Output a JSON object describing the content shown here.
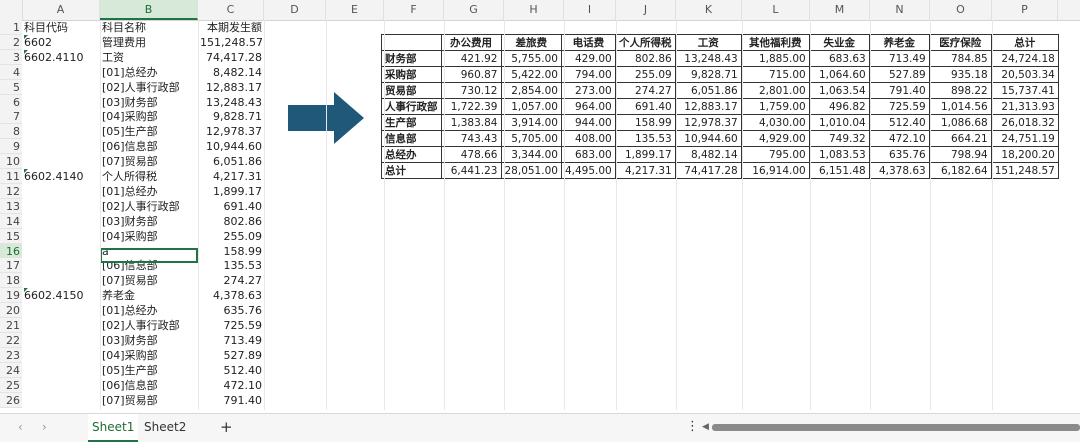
{
  "columns": [
    "A",
    "B",
    "C",
    "D",
    "E",
    "F",
    "G",
    "H",
    "I",
    "J",
    "K",
    "L",
    "M",
    "N",
    "O",
    "P"
  ],
  "rows": [
    {
      "n": "1",
      "a": "科目代码",
      "b": "科目名称",
      "c": "本期发生额"
    },
    {
      "n": "2",
      "a": "6602",
      "b": "管理费用",
      "c": "151,248.57"
    },
    {
      "n": "3",
      "a": "6602.4110",
      "b": "工资",
      "c": "74,417.28"
    },
    {
      "n": "4",
      "a": "",
      "b": "[01]总经办",
      "c": "8,482.14"
    },
    {
      "n": "5",
      "a": "",
      "b": "[02]人事行政部",
      "c": "12,883.17"
    },
    {
      "n": "6",
      "a": "",
      "b": "[03]财务部",
      "c": "13,248.43"
    },
    {
      "n": "7",
      "a": "",
      "b": "[04]采购部",
      "c": "9,828.71"
    },
    {
      "n": "8",
      "a": "",
      "b": "[05]生产部",
      "c": "12,978.37"
    },
    {
      "n": "9",
      "a": "",
      "b": "[06]信息部",
      "c": "10,944.60"
    },
    {
      "n": "10",
      "a": "",
      "b": "[07]贸易部",
      "c": "6,051.86"
    },
    {
      "n": "11",
      "a": "6602.4140",
      "b": "个人所得税",
      "c": "4,217.31"
    },
    {
      "n": "12",
      "a": "",
      "b": "[01]总经办",
      "c": "1,899.17"
    },
    {
      "n": "13",
      "a": "",
      "b": "[02]人事行政部",
      "c": "691.40"
    },
    {
      "n": "14",
      "a": "",
      "b": "[03]财务部",
      "c": "802.86"
    },
    {
      "n": "15",
      "a": "",
      "b": "[04]采购部",
      "c": "255.09"
    },
    {
      "n": "16",
      "a": "",
      "b": "a",
      "c": "158.99"
    },
    {
      "n": "17",
      "a": "",
      "b": "[06]信息部",
      "c": "135.53"
    },
    {
      "n": "18",
      "a": "",
      "b": "[07]贸易部",
      "c": "274.27"
    },
    {
      "n": "19",
      "a": "6602.4150",
      "b": "养老金",
      "c": "4,378.63"
    },
    {
      "n": "20",
      "a": "",
      "b": "[01]总经办",
      "c": "635.76"
    },
    {
      "n": "21",
      "a": "",
      "b": "[02]人事行政部",
      "c": "725.59"
    },
    {
      "n": "22",
      "a": "",
      "b": "[03]财务部",
      "c": "713.49"
    },
    {
      "n": "23",
      "a": "",
      "b": "[04]采购部",
      "c": "527.89"
    },
    {
      "n": "24",
      "a": "",
      "b": "[05]生产部",
      "c": "512.40"
    },
    {
      "n": "25",
      "a": "",
      "b": "[06]信息部",
      "c": "472.10"
    },
    {
      "n": "26",
      "a": "",
      "b": "[07]贸易部",
      "c": "791.40"
    }
  ],
  "pivot": {
    "headers": [
      "",
      "办公费用",
      "差旅费",
      "电话费",
      "个人所得税",
      "工资",
      "其他福利费",
      "失业金",
      "养老金",
      "医疗保险",
      "总计"
    ],
    "rows": [
      [
        "财务部",
        "421.92",
        "5,755.00",
        "429.00",
        "802.86",
        "13,248.43",
        "1,885.00",
        "683.63",
        "713.49",
        "784.85",
        "24,724.18"
      ],
      [
        "采购部",
        "960.87",
        "5,422.00",
        "794.00",
        "255.09",
        "9,828.71",
        "715.00",
        "1,064.60",
        "527.89",
        "935.18",
        "20,503.34"
      ],
      [
        "贸易部",
        "730.12",
        "2,854.00",
        "273.00",
        "274.27",
        "6,051.86",
        "2,801.00",
        "1,063.54",
        "791.40",
        "898.22",
        "15,737.41"
      ],
      [
        "人事行政部",
        "1,722.39",
        "1,057.00",
        "964.00",
        "691.40",
        "12,883.17",
        "1,759.00",
        "496.82",
        "725.59",
        "1,014.56",
        "21,313.93"
      ],
      [
        "生产部",
        "1,383.84",
        "3,914.00",
        "944.00",
        "158.99",
        "12,978.37",
        "4,030.00",
        "1,010.04",
        "512.40",
        "1,086.68",
        "26,018.32"
      ],
      [
        "信息部",
        "743.43",
        "5,705.00",
        "408.00",
        "135.53",
        "10,944.60",
        "4,929.00",
        "749.32",
        "472.10",
        "664.21",
        "24,751.19"
      ],
      [
        "总经办",
        "478.66",
        "3,344.00",
        "683.00",
        "1,899.17",
        "8,482.14",
        "795.00",
        "1,083.53",
        "635.76",
        "798.94",
        "18,200.20"
      ],
      [
        "总计",
        "6,441.23",
        "28,051.00",
        "4,495.00",
        "4,217.31",
        "74,417.28",
        "16,914.00",
        "6,151.48",
        "4,378.63",
        "6,182.64",
        "151,248.57"
      ]
    ]
  },
  "sheets": [
    "Sheet1",
    "Sheet2"
  ],
  "add_sheet": "+",
  "nav": {
    "prev": "‹",
    "next": "›"
  },
  "icons": {
    "arrow": "right-arrow-icon",
    "menu": "vertical-dots-icon"
  },
  "colors": {
    "accent": "#217346",
    "arrow": "#1f5878"
  }
}
